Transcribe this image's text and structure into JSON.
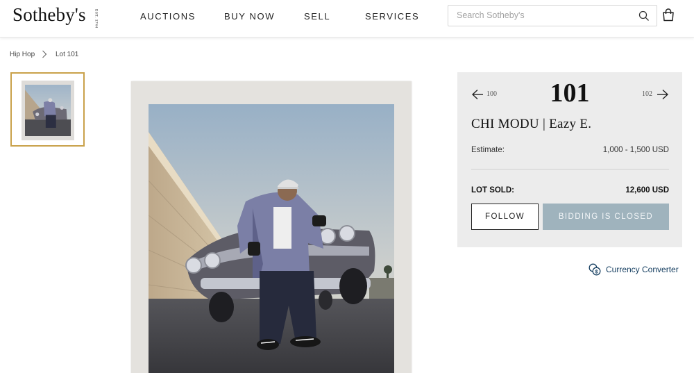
{
  "header": {
    "logo": "Sotheby's",
    "logo_est": "EST. 1744",
    "nav": [
      "AUCTIONS",
      "BUY NOW",
      "SELL",
      "SERVICES"
    ],
    "search_placeholder": "Search Sotheby's",
    "icons": {
      "search": "search-icon",
      "bag": "shopping-bag-icon"
    }
  },
  "breadcrumb": [
    "Hip Hop",
    "Lot 101"
  ],
  "lot": {
    "prev_number": "100",
    "number": "101",
    "next_number": "102",
    "title": "CHI MODU | Eazy E.",
    "estimate_label": "Estimate:",
    "estimate_value": "1,000 - 1,500 USD",
    "sold_label": "LOT SOLD:",
    "sold_value": "12,600 USD",
    "follow_label": "FOLLOW",
    "closed_label": "BIDDING IS CLOSED"
  },
  "currency": {
    "label": "Currency Converter",
    "icon": "currency-exchange-icon"
  },
  "colors": {
    "accent_gold": "#c9a14a",
    "panel_bg": "#ececec",
    "disabled_button": "#9fb3bd",
    "link_blue": "#163f61"
  }
}
